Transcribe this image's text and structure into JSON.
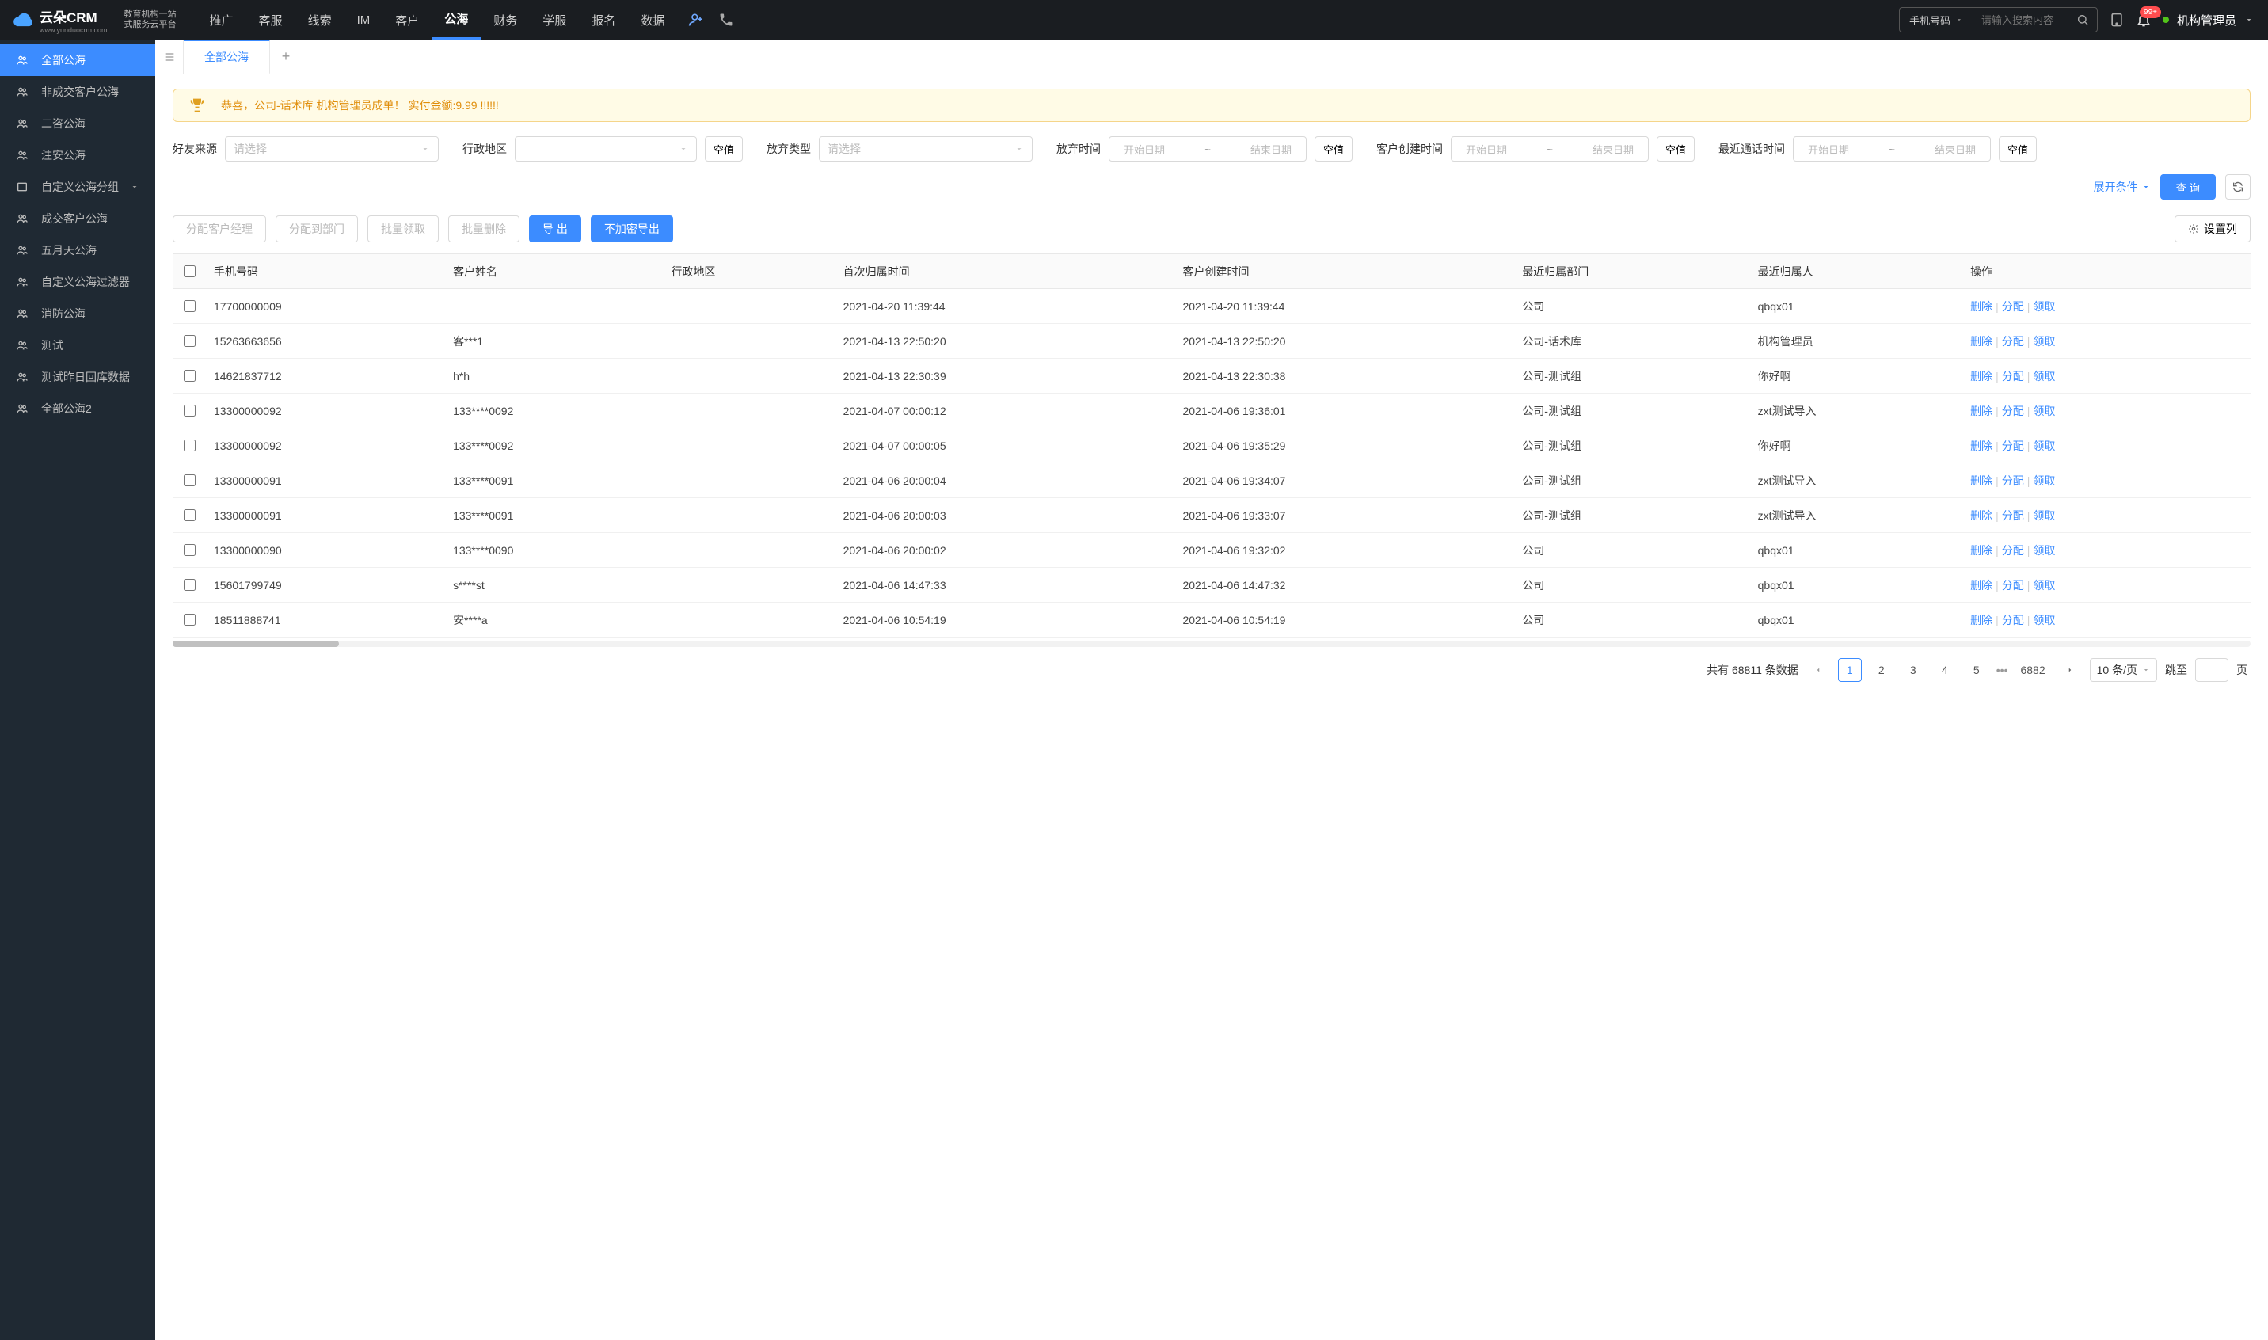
{
  "brand": {
    "name": "云朵CRM",
    "domain": "www.yunduocrm.com",
    "sub1": "教育机构一站",
    "sub2": "式服务云平台"
  },
  "nav": [
    "推广",
    "客服",
    "线索",
    "IM",
    "客户",
    "公海",
    "财务",
    "学服",
    "报名",
    "数据"
  ],
  "nav_active": 5,
  "search": {
    "type": "手机号码",
    "placeholder": "请输入搜索内容"
  },
  "notif_badge": "99+",
  "user": "机构管理员",
  "sidebar": [
    {
      "label": "全部公海"
    },
    {
      "label": "非成交客户公海"
    },
    {
      "label": "二咨公海"
    },
    {
      "label": "注安公海"
    },
    {
      "label": "自定义公海分组",
      "chevron": true
    },
    {
      "label": "成交客户公海"
    },
    {
      "label": "五月天公海"
    },
    {
      "label": "自定义公海过滤器"
    },
    {
      "label": "消防公海"
    },
    {
      "label": "测试"
    },
    {
      "label": "测试昨日回库数据"
    },
    {
      "label": "全部公海2"
    }
  ],
  "sidebar_active": 0,
  "tabs": [
    "全部公海"
  ],
  "notice": "恭喜，公司-话术库  机构管理员成单！  实付金额:9.99 !!!!!!",
  "filters": {
    "friend_source": "好友来源",
    "region": "行政地区",
    "abandon_type": "放弃类型",
    "abandon_time": "放弃时间",
    "create_time": "客户创建时间",
    "last_call": "最近通话时间",
    "select_ph": "请选择",
    "start_ph": "开始日期",
    "end_ph": "结束日期",
    "null_btn": "空值"
  },
  "expand_label": "展开条件",
  "search_btn": "查 询",
  "toolbar": {
    "assign_mgr": "分配客户经理",
    "assign_dept": "分配到部门",
    "batch_claim": "批量领取",
    "batch_delete": "批量删除",
    "export": "导 出",
    "export_plain": "不加密导出",
    "columns": "设置列"
  },
  "columns": [
    "手机号码",
    "客户姓名",
    "行政地区",
    "首次归属时间",
    "客户创建时间",
    "最近归属部门",
    "最近归属人",
    "操作"
  ],
  "ops": {
    "delete": "删除",
    "assign": "分配",
    "claim": "领取"
  },
  "rows": [
    {
      "phone": "17700000009",
      "name": "",
      "region": "",
      "first": "2021-04-20 11:39:44",
      "create": "2021-04-20 11:39:44",
      "dept": "公司",
      "owner": "qbqx01"
    },
    {
      "phone": "15263663656",
      "name": "客***1",
      "region": "",
      "first": "2021-04-13 22:50:20",
      "create": "2021-04-13 22:50:20",
      "dept": "公司-话术库",
      "owner": "机构管理员"
    },
    {
      "phone": "14621837712",
      "name": "h*h",
      "region": "",
      "first": "2021-04-13 22:30:39",
      "create": "2021-04-13 22:30:38",
      "dept": "公司-测试组",
      "owner": "你好啊"
    },
    {
      "phone": "13300000092",
      "name": "133****0092",
      "region": "",
      "first": "2021-04-07 00:00:12",
      "create": "2021-04-06 19:36:01",
      "dept": "公司-测试组",
      "owner": "zxt测试导入"
    },
    {
      "phone": "13300000092",
      "name": "133****0092",
      "region": "",
      "first": "2021-04-07 00:00:05",
      "create": "2021-04-06 19:35:29",
      "dept": "公司-测试组",
      "owner": "你好啊"
    },
    {
      "phone": "13300000091",
      "name": "133****0091",
      "region": "",
      "first": "2021-04-06 20:00:04",
      "create": "2021-04-06 19:34:07",
      "dept": "公司-测试组",
      "owner": "zxt测试导入"
    },
    {
      "phone": "13300000091",
      "name": "133****0091",
      "region": "",
      "first": "2021-04-06 20:00:03",
      "create": "2021-04-06 19:33:07",
      "dept": "公司-测试组",
      "owner": "zxt测试导入"
    },
    {
      "phone": "13300000090",
      "name": "133****0090",
      "region": "",
      "first": "2021-04-06 20:00:02",
      "create": "2021-04-06 19:32:02",
      "dept": "公司",
      "owner": "qbqx01"
    },
    {
      "phone": "15601799749",
      "name": "s****st",
      "region": "",
      "first": "2021-04-06 14:47:33",
      "create": "2021-04-06 14:47:32",
      "dept": "公司",
      "owner": "qbqx01"
    },
    {
      "phone": "18511888741",
      "name": "安****a",
      "region": "",
      "first": "2021-04-06 10:54:19",
      "create": "2021-04-06 10:54:19",
      "dept": "公司",
      "owner": "qbqx01"
    }
  ],
  "pagination": {
    "total_prefix": "共有 ",
    "total": "68811",
    "total_suffix": " 条数据",
    "pages": [
      "1",
      "2",
      "3",
      "4",
      "5"
    ],
    "last": "6882",
    "size_label": "10 条/页",
    "jump_prefix": "跳至",
    "jump_suffix": "页"
  }
}
